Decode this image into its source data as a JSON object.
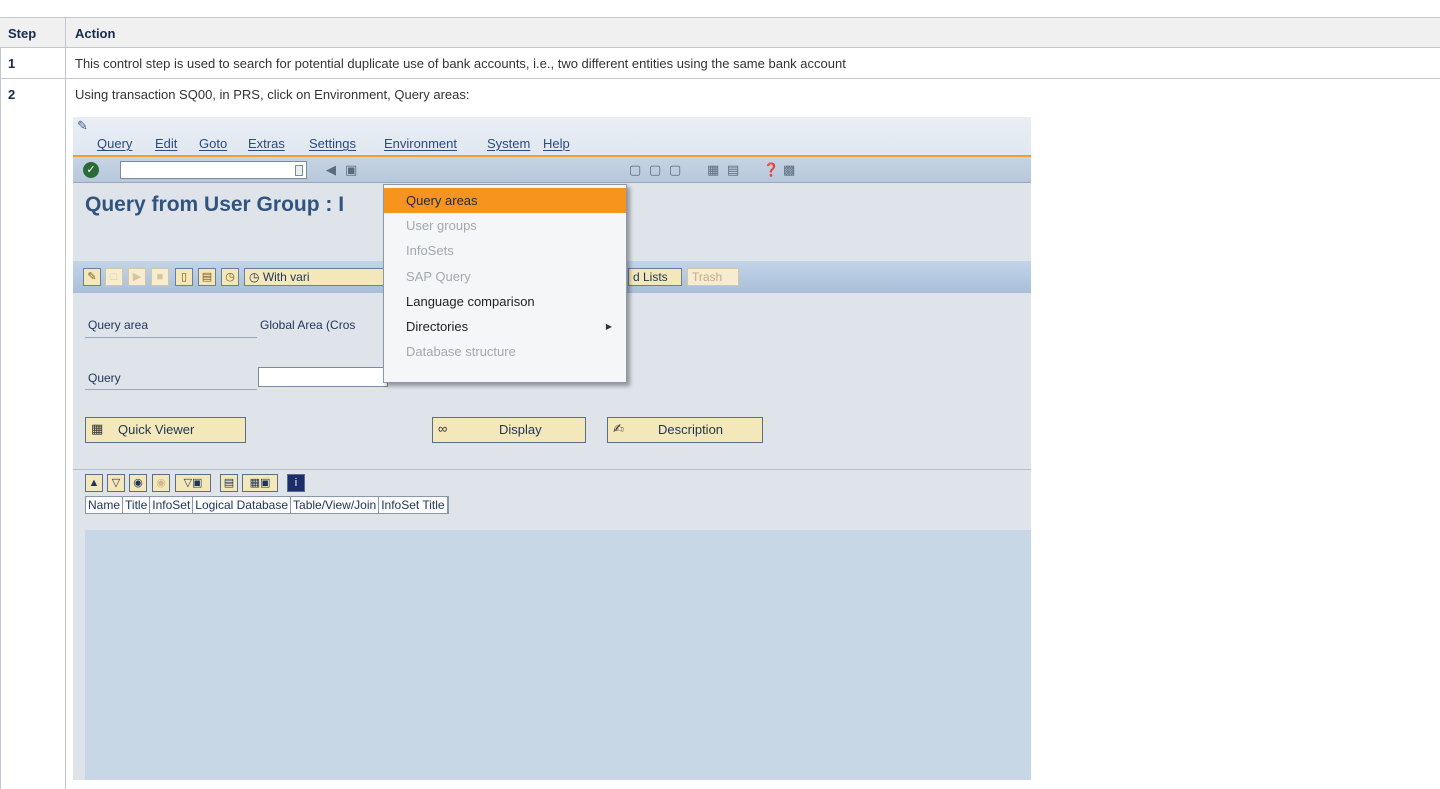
{
  "table": {
    "headers": {
      "step": "Step",
      "action": "Action"
    },
    "rows": [
      {
        "step": "1",
        "action": "This control step is used to search for potential duplicate use of bank accounts, i.e., two different entities using the same bank account"
      },
      {
        "step": "2",
        "action": "Using transaction SQ00, in PRS, click on Environment, Query areas:"
      }
    ]
  },
  "sap": {
    "menu": [
      "Query",
      "Edit",
      "Goto",
      "Extras",
      "Settings",
      "Environment",
      "System",
      "Help"
    ],
    "title": "Query from User Group : I",
    "app_buttons": {
      "with_variant": "With vari",
      "saved_lists": "d Lists",
      "trash": "Trash"
    },
    "fields": {
      "query_area_label": "Query area",
      "query_area_value": "Global Area (Cros",
      "query_label": "Query"
    },
    "push_buttons": {
      "quick_viewer": "Quick Viewer",
      "display": "Display",
      "description": "Description"
    },
    "columns": [
      "Name",
      "Title",
      "InfoSet",
      "Logical Database",
      "Table/View/Join",
      "InfoSet Title"
    ],
    "environment_menu": [
      {
        "label": "Query areas",
        "state": "highlighted"
      },
      {
        "label": "User groups",
        "state": "disabled"
      },
      {
        "label": "InfoSets",
        "state": "disabled"
      },
      {
        "label": "SAP Query",
        "state": "disabled"
      },
      {
        "label": "Language comparison",
        "state": "enabled"
      },
      {
        "label": "Directories",
        "state": "enabled",
        "submenu": true
      },
      {
        "label": "Database structure",
        "state": "disabled"
      }
    ]
  },
  "icons": {
    "ok": "check-icon",
    "menu_submenu": "chevron-right-icon",
    "info": "info-icon"
  },
  "colors": {
    "accent": "#f7941d",
    "title": "#31547f",
    "grid": "#c7d7e6"
  }
}
